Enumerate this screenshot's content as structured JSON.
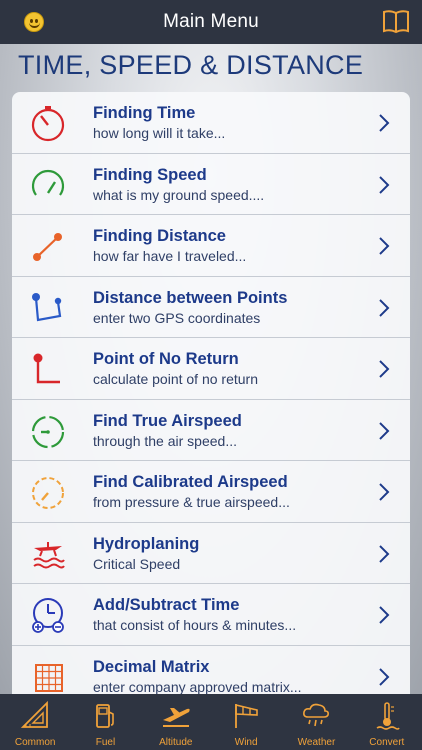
{
  "header": {
    "title": "Main Menu",
    "left_icon": "smiley-icon",
    "right_icon": "book-icon"
  },
  "section_title": "TIME, SPEED & DISTANCE",
  "colors": {
    "bar": "#2e3441",
    "accent": "#f0a23a",
    "title_blue": "#1d3a8a"
  },
  "items": [
    {
      "title": "Finding Time",
      "subtitle": "how long will it take...",
      "icon": "stopwatch-red-icon"
    },
    {
      "title": "Finding Speed",
      "subtitle": "what is my ground speed....",
      "icon": "speedometer-green-icon"
    },
    {
      "title": "Finding Distance",
      "subtitle": "how far have I traveled...",
      "icon": "distance-line-icon"
    },
    {
      "title": "Distance between Points",
      "subtitle": "enter two GPS coordinates",
      "icon": "gps-points-icon"
    },
    {
      "title": "Point of No Return",
      "subtitle": "calculate point of no return",
      "icon": "no-return-icon"
    },
    {
      "title": "Find True Airspeed",
      "subtitle": "through the air speed...",
      "icon": "true-airspeed-gauge-icon"
    },
    {
      "title": "Find Calibrated Airspeed",
      "subtitle": "from pressure & true airspeed...",
      "icon": "calibrated-airspeed-gauge-icon"
    },
    {
      "title": "Hydroplaning",
      "subtitle": "Critical Speed",
      "icon": "hydroplaning-plane-icon"
    },
    {
      "title": "Add/Subtract Time",
      "subtitle": "that consist of hours & minutes...",
      "icon": "clock-add-subtract-icon"
    },
    {
      "title": "Decimal Matrix",
      "subtitle": "enter company approved matrix...",
      "icon": "matrix-grid-icon"
    }
  ],
  "tabs": [
    {
      "label": "Common",
      "icon": "ruler-triangle-icon"
    },
    {
      "label": "Fuel",
      "icon": "fuel-pump-icon"
    },
    {
      "label": "Altitude",
      "icon": "airplane-takeoff-icon"
    },
    {
      "label": "Wind",
      "icon": "windsock-icon"
    },
    {
      "label": "Weather",
      "icon": "rain-cloud-icon"
    },
    {
      "label": "Convert",
      "icon": "thermometer-icon"
    }
  ]
}
